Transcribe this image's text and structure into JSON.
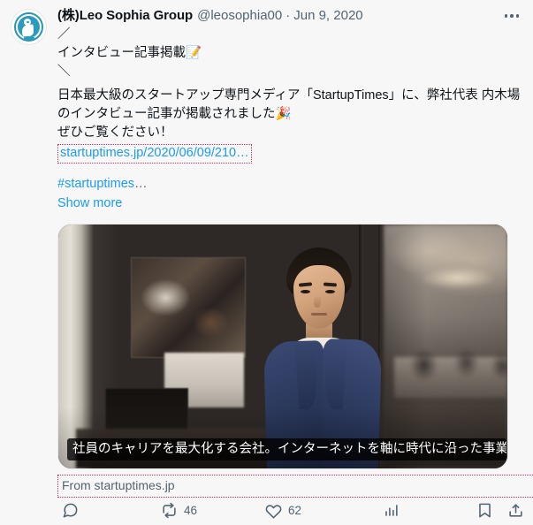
{
  "post": {
    "author": {
      "display_name": "(株)Leo Sophia Group",
      "handle": "@leosophia00",
      "separator": "·",
      "date": "Jun 9, 2020",
      "avatar_icon": "leo-sophia-logo-icon"
    },
    "more_menu_icon": "more-horizontal-icon",
    "text": {
      "line1": "／",
      "line2": "インタビュー記事掲載📝",
      "line3": "＼",
      "line4": "日本最大級のスタートアップ専門メディア「StartupTimes」に、弊社代表 内木場のインタビュー記事が掲載されました🎉",
      "line5": "ぜひご覧ください！",
      "url_label": "startuptimes.jp/2020/06/09/210…",
      "hashtag": "#startuptimes",
      "hashtag_ellipsis": "…",
      "show_more_label": "Show more"
    },
    "media": {
      "type": "photo",
      "alt_description": "Man in navy blazer standing in an office",
      "caption": "社員のキャリアを最大化する会社。インターネットを軸に時代に沿った事業を展…"
    },
    "source_label": "From startuptimes.jp",
    "actions": {
      "reply": {
        "icon": "reply-icon",
        "count": ""
      },
      "retweet": {
        "icon": "retweet-icon",
        "count": "46"
      },
      "like": {
        "icon": "heart-icon",
        "count": "62"
      },
      "views": {
        "icon": "analytics-bar-chart-icon",
        "count": ""
      },
      "bookmark": {
        "icon": "bookmark-icon"
      },
      "share": {
        "icon": "share-upload-icon"
      }
    }
  },
  "colors": {
    "link_blue": "#1d9bf0",
    "text_primary": "#0f1419",
    "text_secondary": "#536471",
    "highlight_box": "#e0245e",
    "page_background": "#f7f7f7",
    "avatar_teal": "#2a9bbd"
  }
}
